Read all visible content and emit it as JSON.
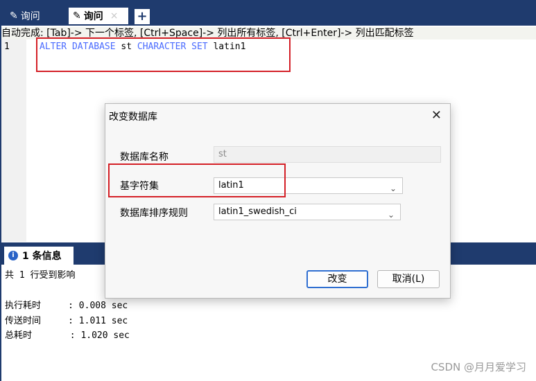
{
  "tabs": [
    {
      "label": "询问"
    },
    {
      "label": "询问",
      "close": "×"
    }
  ],
  "tab_add": "+",
  "hint": "自动完成: [Tab]-> 下一个标签, [Ctrl+Space]-> 列出所有标签, [Ctrl+Enter]-> 列出匹配标签",
  "editor": {
    "line_number": "1",
    "kw1": "ALTER DATABASE",
    "ident": " st ",
    "kw2": "CHARACTER SET",
    "value": " latin1"
  },
  "messages": {
    "tab_label": "1 条信息",
    "info_icon": "i",
    "lines": [
      "共 1 行受到影响",
      "",
      "执行耗时     : 0.008 sec",
      "传送时间     : 1.011 sec",
      "总耗时       : 1.020 sec"
    ]
  },
  "dialog": {
    "title": "改变数据库",
    "close": "✕",
    "db_name_label": "数据库名称",
    "db_name_value": "st",
    "charset_label": "基字符集",
    "charset_value": "latin1",
    "collation_label": "数据库排序规则",
    "collation_value": "latin1_swedish_ci",
    "ok_label": "改变",
    "cancel_label": "取消(L)"
  },
  "watermark": "CSDN @月月爱学习",
  "colors": {
    "tabbar": "#1f3b6e",
    "keyword": "#4a6bff",
    "highlight_border": "#d41f26"
  }
}
